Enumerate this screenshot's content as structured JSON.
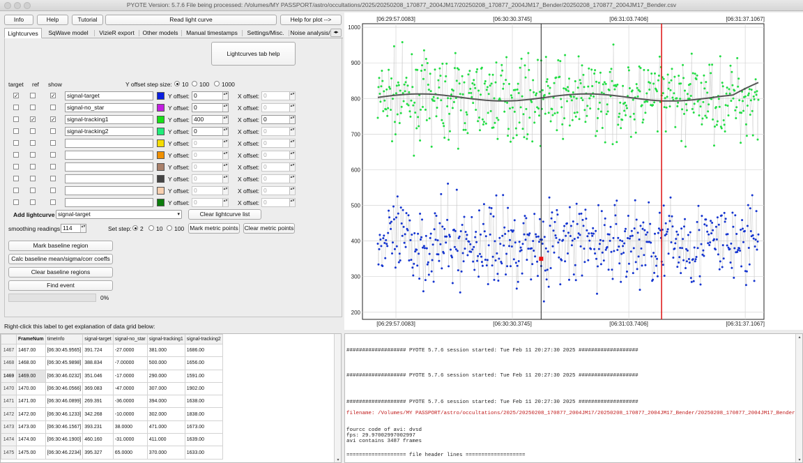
{
  "window": {
    "title": "PYOTE Version: 5.7.6  File being processed: /Volumes/MY PASSPORT/astro/occultations/2025/20250208_170877_2004JM17/20250208_170877_2004JM17_Bender/20250208_170877_2004JM17_Bender.csv"
  },
  "toolbar": {
    "info": "Info",
    "help": "Help",
    "tutorial": "Tutorial",
    "read_light_curve": "Read light curve",
    "help_for_plot": "Help for plot -->"
  },
  "tabs": [
    "Lightcurves",
    "SqWave model",
    "VizieR export",
    "Other models",
    "Manual timestamps",
    "Settings/Misc.",
    "Noise analysis/"
  ],
  "tab_scroll": "◂▸",
  "lightcurves_tab": {
    "help_button": "Lightcurves tab help",
    "col_target": "target",
    "col_ref": "ref",
    "col_show": "show",
    "y_step_label": "Y offset step size:",
    "y_step_options": [
      "10",
      "100",
      "1000"
    ],
    "y_offset_label": "Y offset:",
    "x_offset_label": "X offset:",
    "spin_glyph": "▴▾",
    "check_glyph": "✓",
    "rows": [
      {
        "target": true,
        "ref": false,
        "show": true,
        "name": "signal-target",
        "color": "#0a1fe0",
        "y": "0",
        "x": "0",
        "enabled": true,
        "x_enabled": false
      },
      {
        "target": false,
        "ref": false,
        "show": false,
        "name": "signal-no_star",
        "color": "#c21ee0",
        "y": "0",
        "x": "0",
        "enabled": true,
        "x_enabled": false
      },
      {
        "target": false,
        "ref": true,
        "show": true,
        "name": "signal-tracking1",
        "color": "#18e018",
        "y": "400",
        "x": "0",
        "enabled": true,
        "x_enabled": true
      },
      {
        "target": false,
        "ref": false,
        "show": false,
        "name": "signal-tracking2",
        "color": "#20ec7a",
        "y": "0",
        "x": "0",
        "enabled": true,
        "x_enabled": false
      },
      {
        "target": false,
        "ref": false,
        "show": false,
        "name": "",
        "color": "#f5dc00",
        "y": "0",
        "x": "0",
        "enabled": false,
        "x_enabled": false
      },
      {
        "target": false,
        "ref": false,
        "show": false,
        "name": "",
        "color": "#f09000",
        "y": "0",
        "x": "0",
        "enabled": false,
        "x_enabled": false
      },
      {
        "target": false,
        "ref": false,
        "show": false,
        "name": "",
        "color": "#a9806a",
        "y": "0",
        "x": "0",
        "enabled": false,
        "x_enabled": false
      },
      {
        "target": false,
        "ref": false,
        "show": false,
        "name": "",
        "color": "#444444",
        "y": "0",
        "x": "0",
        "enabled": false,
        "x_enabled": false
      },
      {
        "target": false,
        "ref": false,
        "show": false,
        "name": "",
        "color": "#f8d0b0",
        "y": "0",
        "x": "0",
        "enabled": false,
        "x_enabled": false
      },
      {
        "target": false,
        "ref": false,
        "show": false,
        "name": "",
        "color": "#0c7c0c",
        "y": "0",
        "x": "0",
        "enabled": false,
        "x_enabled": false
      }
    ],
    "add_lightcurve_label": "Add lightcurve",
    "add_lightcurve_value": "signal-target",
    "clear_list": "Clear lightcurve list",
    "smoothing_label": "smoothing readings",
    "smoothing_value": "114",
    "set_step_label": "Set step:",
    "set_step_options": [
      "2",
      "10",
      "100"
    ],
    "mark_metric": "Mark metric points",
    "clear_metric": "Clear metric points",
    "mark_baseline": "Mark baseline region",
    "calc_baseline": "Calc baseline mean/sigma/corr coeffs",
    "clear_baseline": "Clear baseline regions",
    "find_event": "Find event",
    "progress_text": "0%",
    "progress_value": 0
  },
  "chart_data": {
    "type": "scatter",
    "series": [
      {
        "name": "signal-tracking1",
        "color": "#22dd44",
        "center": 800,
        "spread": 55,
        "yoffset": 400
      },
      {
        "name": "signal-target",
        "color": "#1535d0",
        "center": 393,
        "spread": 60,
        "yoffset": 0
      }
    ],
    "smoothed_color": "#555555",
    "ylim": [
      180,
      1010
    ],
    "yticks": [
      200,
      300,
      400,
      500,
      600,
      700,
      800,
      900,
      1000
    ],
    "xticks": [
      "[06:29:57.0083]",
      "[06:30:30.3745]",
      "[06:31:03.7406]",
      "[06:31:37.1067]"
    ],
    "n_points": 560,
    "markers": {
      "black_line": 0.445,
      "red_line": 0.745,
      "red_point_y": 350
    },
    "grid": true
  },
  "grid_help_label": "Right-click this label to get explanation of data grid below:",
  "data_grid": {
    "columns": [
      "FrameNum",
      "timeInfo",
      "signal-target",
      "signal-no_star",
      "signal-tracking1",
      "signal-tracking2"
    ],
    "rows": [
      [
        "1467",
        "1467.00",
        "[06:30:45.9565]",
        "391.724",
        "-27.0000",
        "381.000",
        "1686.00"
      ],
      [
        "1468",
        "1468.00",
        "[06:30:45.9898]",
        "388.834",
        "-7.00000",
        "500.000",
        "1656.00"
      ],
      [
        "1469",
        "1469.00",
        "[06:30:46.0232]",
        "351.046",
        "-17.0000",
        "290.000",
        "1591.00"
      ],
      [
        "1470",
        "1470.00",
        "[06:30:46.0566]",
        "369.083",
        "-47.0000",
        "307.000",
        "1902.00"
      ],
      [
        "1471",
        "1471.00",
        "[06:30:46.0899]",
        "269.391",
        "-36.0000",
        "394.000",
        "1638.00"
      ],
      [
        "1472",
        "1472.00",
        "[06:30:46.1233]",
        "342.268",
        "-10.0000",
        "302.000",
        "1838.00"
      ],
      [
        "1473",
        "1473.00",
        "[06:30:46.1567]",
        "393.231",
        "38.0000",
        "471.000",
        "1673.00"
      ],
      [
        "1474",
        "1474.00",
        "[06:30:46.1900]",
        "460.160",
        "-31.0000",
        "411.000",
        "1639.00"
      ],
      [
        "1475",
        "1475.00",
        "[06:30:46.2234]",
        "395.327",
        "65.0000",
        "370.000",
        "1633.00"
      ]
    ]
  },
  "log": {
    "lines": [
      {
        "text": "################### PYOTE 5.7.6 session started: Tue Feb 11 20:27:30 2025 ###################",
        "red": false
      },
      {
        "text": "################### PYOTE 5.7.6 session started: Tue Feb 11 20:27:30 2025 ###################",
        "red": false
      },
      {
        "text": "################### PYOTE 5.7.6 session started: Tue Feb 11 20:27:30 2025 ###################",
        "red": false
      },
      {
        "text": "filename: /Volumes/MY PASSPORT/astro/occultations/2025/20250208_170877_2004JM17/20250208_170877_2004JM17_Bender/20250208_170877_2004JM17_Bender.csv",
        "red": true
      },
      {
        "text": "fourcc code of avi: dvsd",
        "red": false
      },
      {
        "text": "fps: 29.97002997002997",
        "red": false
      },
      {
        "text": "avi contains 3487 frames",
        "red": false
      },
      {
        "text": "=================== file header lines ===================",
        "red": false
      }
    ]
  }
}
